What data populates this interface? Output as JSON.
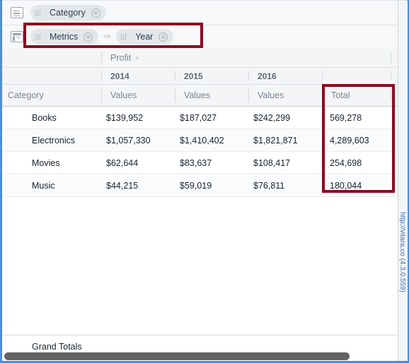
{
  "shelves": [
    {
      "icon": "rows-icon",
      "pills": [
        {
          "label": "Category",
          "close": "⊗",
          "id": "category"
        }
      ]
    },
    {
      "icon": "pivot-icon",
      "pills": [
        {
          "label": "Metrics",
          "close": "⊗",
          "id": "metrics"
        },
        {
          "label": "Year",
          "close": "⊗",
          "id": "year"
        }
      ],
      "arrow": "⇨"
    }
  ],
  "table": {
    "measure_group": "Profit",
    "measure_chevron": "‹",
    "year_headers": [
      "2014",
      "2015",
      "2016"
    ],
    "corner_label": "Category",
    "value_headers": [
      "Values",
      "Values",
      "Values"
    ],
    "total_header": "Total",
    "rows": [
      {
        "category": "Books",
        "values": [
          "$139,952",
          "$187,027",
          "$242,299"
        ],
        "total": "569,278"
      },
      {
        "category": "Electronics",
        "values": [
          "$1,057,330",
          "$1,410,402",
          "$1,821,871"
        ],
        "total": "4,289,603"
      },
      {
        "category": "Movies",
        "values": [
          "$62,644",
          "$83,637",
          "$108,417"
        ],
        "total": "254,698"
      },
      {
        "category": "Music",
        "values": [
          "$44,215",
          "$59,019",
          "$76,811"
        ],
        "total": "180,044"
      }
    ],
    "grand_totals_label": "Grand Totals"
  },
  "watermark": "http://vitara.co (4.3.0.559)",
  "colors": {
    "accent_border": "#4a90d9",
    "annotation": "#8c0b22",
    "pill_bg": "#e3e7ea",
    "header_bg": "#f4f5f6"
  }
}
